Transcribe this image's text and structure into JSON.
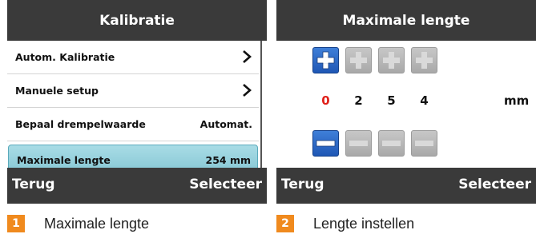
{
  "colors": {
    "bar": "#3a3a3a",
    "selected": "#84c6d3",
    "accent_digit": "#e0201a",
    "badge": "#f08a1e",
    "key_active": "#2a68c8"
  },
  "left_panel": {
    "title": "Kalibratie",
    "menu": [
      {
        "label": "Autom. Kalibratie",
        "value": "",
        "icon": "chevron-right-icon"
      },
      {
        "label": "Manuele setup",
        "value": "",
        "icon": "chevron-right-icon"
      },
      {
        "label": "Bepaal drempelwaarde",
        "value": "Automat.",
        "icon": ""
      },
      {
        "label": "Maximale lengte",
        "value": "254 mm",
        "icon": "",
        "selected": true
      }
    ],
    "back_label": "Terug",
    "select_label": "Selecteer"
  },
  "right_panel": {
    "title": "Maximale lengte",
    "digits": [
      "0",
      "2",
      "5",
      "4"
    ],
    "active_digit_index": 0,
    "unit": "mm",
    "increment_icon": "plus-icon",
    "decrement_icon": "minus-icon",
    "back_label": "Terug",
    "select_label": "Selecteer"
  },
  "captions": [
    {
      "number": "1",
      "text": "Maximale lengte"
    },
    {
      "number": "2",
      "text": "Lengte instellen"
    }
  ]
}
